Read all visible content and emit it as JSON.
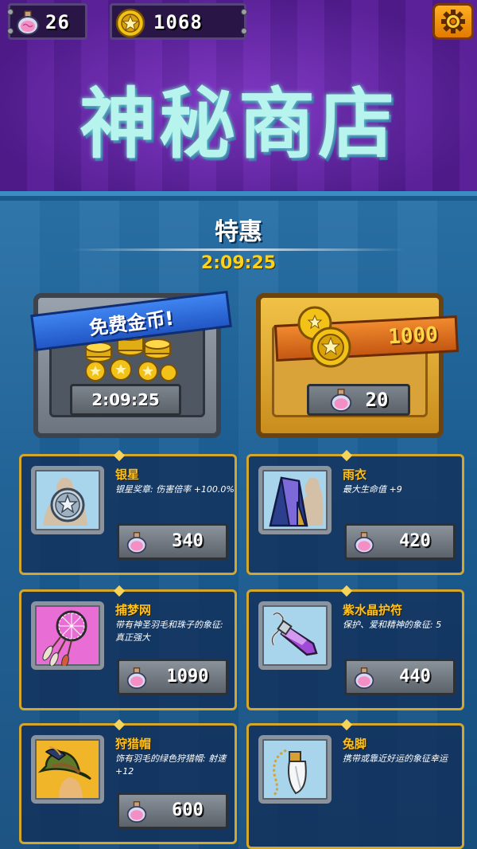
{
  "resources": {
    "brains": "26",
    "coins": "1068"
  },
  "shop": {
    "title": "神秘商店"
  },
  "deals": {
    "title": "特惠",
    "timer": "2:09:25",
    "free_offer": {
      "label": "免费金币!",
      "timer": "2:09:25"
    },
    "coin_offer": {
      "amount": "1000",
      "price": "20"
    }
  },
  "items": [
    {
      "name": "银星",
      "desc": "银星奖章: 伤害倍率 +100.0%",
      "price": "340",
      "icon": "silver-star-icon"
    },
    {
      "name": "雨衣",
      "desc": "最大生命值 +9",
      "price": "420",
      "icon": "raincoat-icon"
    },
    {
      "name": "捕梦网",
      "desc": "带有神圣羽毛和珠子的象征: 真正强大",
      "price": "1090",
      "icon": "dreamcatcher-icon"
    },
    {
      "name": "紫水晶护符",
      "desc": "保护、爱和精神的象征: 5",
      "price": "440",
      "icon": "amethyst-amulet-icon"
    },
    {
      "name": "狩猎帽",
      "desc": "饰有羽毛的绿色狩猎帽: 射速 +12",
      "price": "600",
      "icon": "hunting-hat-icon"
    },
    {
      "name": "兔脚",
      "desc": "携带或靠近好运的象征幸运",
      "price": "",
      "icon": "rabbit-foot-icon"
    }
  ],
  "colors": {
    "accent_gold": "#ffc21a",
    "title_cyan": "#b8f4ee",
    "header_purple": "#5b1fa0",
    "background_blue": "#1b5e93"
  }
}
